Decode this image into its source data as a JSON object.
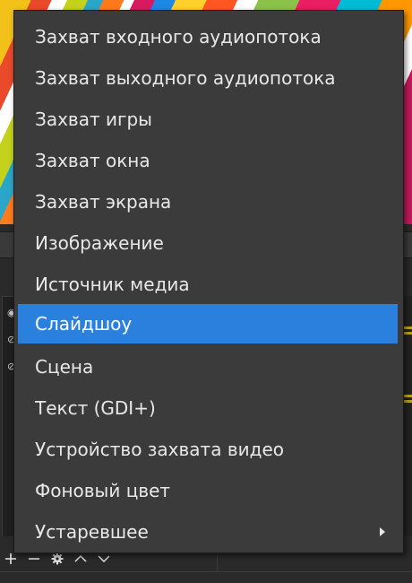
{
  "context_menu": {
    "items": [
      {
        "label": "Захват входного аудиопотока"
      },
      {
        "label": "Захват выходного аудиопотока"
      },
      {
        "label": "Захват игры"
      },
      {
        "label": "Захват окна"
      },
      {
        "label": "Захват экрана"
      },
      {
        "label": "Изображение"
      },
      {
        "label": "Источник медиа"
      },
      {
        "label": "Слайдшоу",
        "selected": true
      },
      {
        "label": "Сцена"
      },
      {
        "label": "Текст (GDI+)"
      },
      {
        "label": "Устройство захвата видео"
      },
      {
        "label": "Фоновый цвет"
      },
      {
        "label": "Устаревшее",
        "has_submenu": true
      }
    ],
    "selected_color": "#2c80dd",
    "background_color": "#3b3b3b"
  },
  "sources_toolbar": {
    "icons": [
      "add-icon",
      "remove-icon",
      "gear-icon",
      "move-up-icon",
      "move-down-icon"
    ]
  }
}
